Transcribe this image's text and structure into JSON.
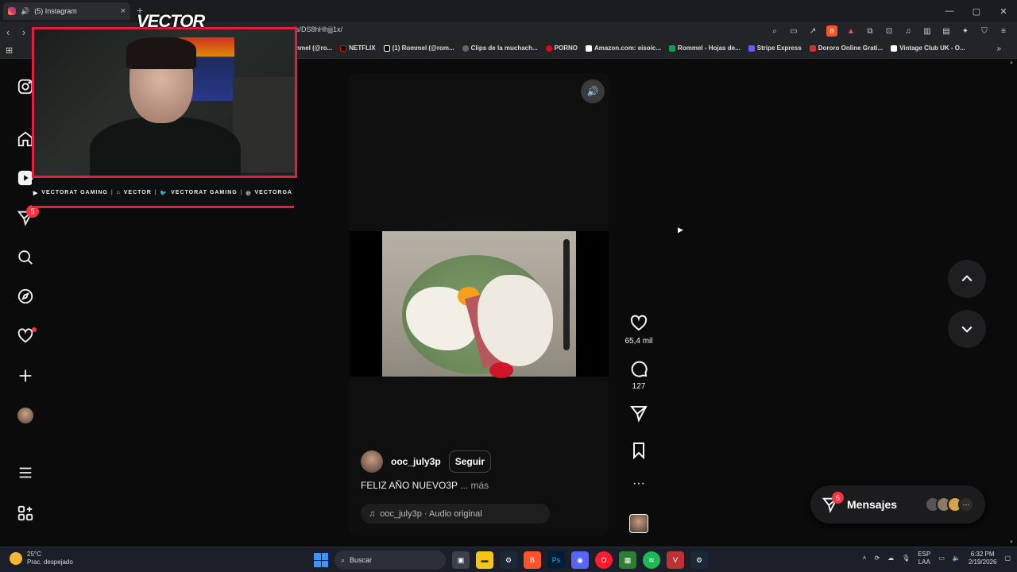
{
  "browser": {
    "tab_title": "(5) Instagram",
    "url": "ls/DS8hHhjjj1x/",
    "bookmarks": [
      "mmel (@ro...",
      "NETFLIX",
      "(1) Rommel (@rom...",
      "Clips de la muchach...",
      "PORNO",
      "Amazon.com: eisoic...",
      "Rommel - Hojas de...",
      "Stripe Express",
      "Dororo Online Grati...",
      "Vintage Club UK - O..."
    ]
  },
  "overlay": {
    "logo": "VECTOR",
    "socials": [
      "VECTORAT GAMING",
      "VECTOR",
      "VECTORAT GAMING",
      "VECTORGA"
    ]
  },
  "sidebar": {
    "icons": [
      "instagram-icon",
      "home-icon",
      "reels-icon",
      "messages-icon",
      "search-icon",
      "explore-icon",
      "notifications-icon",
      "create-icon",
      "profile-avatar",
      "menu-icon",
      "more-apps-icon"
    ],
    "messages_badge": "5"
  },
  "reel": {
    "username": "ooc_july3p",
    "follow_label": "Seguir",
    "caption": "FELIZ AÑO NUEVO3P",
    "more_label": "... más",
    "audio": "ooc_july3p · Audio original",
    "likes": "65,4 mil",
    "comments": "127"
  },
  "messages": {
    "label": "Mensajes",
    "badge": "5"
  },
  "taskbar": {
    "temp": "25°C",
    "weather": "Prac. despejado",
    "search_label": "Buscar",
    "lang1": "ESP",
    "lang2": "LAA",
    "time": "6:32 PM",
    "date": "2/19/2026"
  },
  "colors": {
    "accent": "#ff3040",
    "overlay_red": "#e41e3f"
  }
}
